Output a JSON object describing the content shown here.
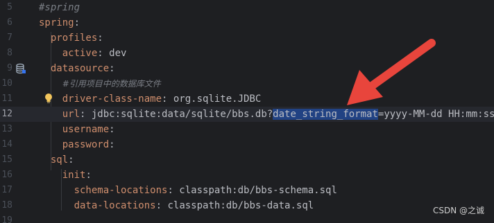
{
  "lines": [
    {
      "no": "5",
      "indent": "",
      "key": "",
      "colon": "",
      "value": "",
      "comment": "#spring"
    },
    {
      "no": "6",
      "indent": "",
      "key": "spring",
      "colon": ":",
      "value": ""
    },
    {
      "no": "7",
      "indent": "  ",
      "key": "profiles",
      "colon": ":",
      "value": ""
    },
    {
      "no": "8",
      "indent": "    ",
      "key": "active",
      "colon": ":",
      "value": " dev"
    },
    {
      "no": "9",
      "indent": "  ",
      "key": "datasource",
      "colon": ":",
      "value": ""
    },
    {
      "no": "10",
      "indent": "    ",
      "key": "",
      "colon": "",
      "value": "",
      "comment": "#引用项目中的数据库文件"
    },
    {
      "no": "11",
      "indent": "    ",
      "key": "driver-class-name",
      "colon": ":",
      "value": " org.sqlite.JDBC"
    },
    {
      "no": "12",
      "indent": "    ",
      "key": "url",
      "colon": ":",
      "value_before": " jdbc:sqlite:data/sqlite/bbs.db?",
      "value_selected": "date_string_format",
      "value_after": "=yyyy-MM-dd HH:mm:ss"
    },
    {
      "no": "13",
      "indent": "    ",
      "key": "username",
      "colon": ":",
      "value": ""
    },
    {
      "no": "14",
      "indent": "    ",
      "key": "password",
      "colon": ":",
      "value": ""
    },
    {
      "no": "15",
      "indent": "  ",
      "key": "sql",
      "colon": ":",
      "value": ""
    },
    {
      "no": "16",
      "indent": "    ",
      "key": "init",
      "colon": ":",
      "value": ""
    },
    {
      "no": "17",
      "indent": "      ",
      "key": "schema-locations",
      "colon": ":",
      "value": " classpath:db/bbs-schema.sql"
    },
    {
      "no": "18",
      "indent": "      ",
      "key": "data-locations",
      "colon": ":",
      "value": " classpath:db/bbs-data.sql"
    },
    {
      "no": "19",
      "indent": "",
      "key": "",
      "colon": "",
      "value": ""
    }
  ],
  "watermark": "CSDN @之诚",
  "colors": {
    "key": "#cf8e6d",
    "comment": "#7a7e85",
    "selection": "#214283",
    "arrow": "#e8453c"
  },
  "icons": {
    "gutter_line9": "database-icon",
    "line11": "lightbulb-icon",
    "annotation": "red-arrow"
  }
}
